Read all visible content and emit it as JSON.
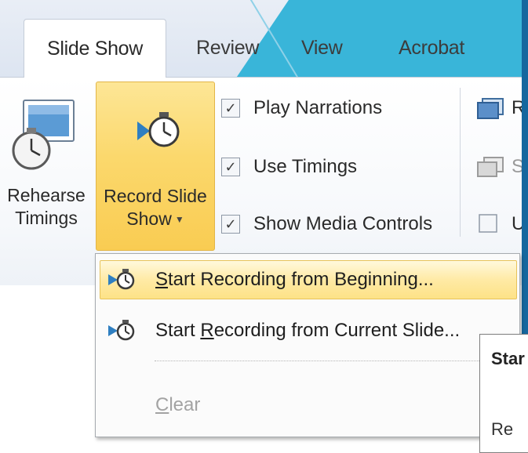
{
  "tabs": [
    {
      "label": "Slide Show",
      "active": true
    },
    {
      "label": "Review"
    },
    {
      "label": "View"
    },
    {
      "label": "Acrobat"
    }
  ],
  "ribbon": {
    "rehearse_timings": {
      "line1": "Rehearse",
      "line2": "Timings",
      "icon": "stopwatch-slide-icon"
    },
    "record_slide_show": {
      "line1": "Record Slide",
      "line2": "Show",
      "icon": "record-stopwatch-icon",
      "state": "pressed"
    },
    "checkboxes": [
      {
        "label": "Play Narrations",
        "checked": true
      },
      {
        "label": "Use Timings",
        "checked": true
      },
      {
        "label": "Show Media Controls",
        "checked": true
      }
    ],
    "monitors_group": {
      "row1_text": "R",
      "row2_text": "S",
      "row3_text": "U"
    }
  },
  "dropdown": {
    "items": [
      {
        "pre": "",
        "underlined": "S",
        "post": "tart Recording from Beginning...",
        "highlighted": true,
        "icon": "record-stopwatch-icon"
      },
      {
        "pre": "Start ",
        "underlined": "R",
        "post": "ecording from Current Slide...",
        "highlighted": false,
        "icon": "record-stopwatch-icon"
      },
      {
        "pre": "",
        "underlined": "C",
        "post": "lear",
        "disabled": true
      }
    ]
  },
  "tooltip": {
    "title": "Star",
    "body": "Re"
  },
  "colors": {
    "accent_highlight": "#fbd86c",
    "window_edge": "#16679e",
    "background_accent": "#39b5d9"
  }
}
